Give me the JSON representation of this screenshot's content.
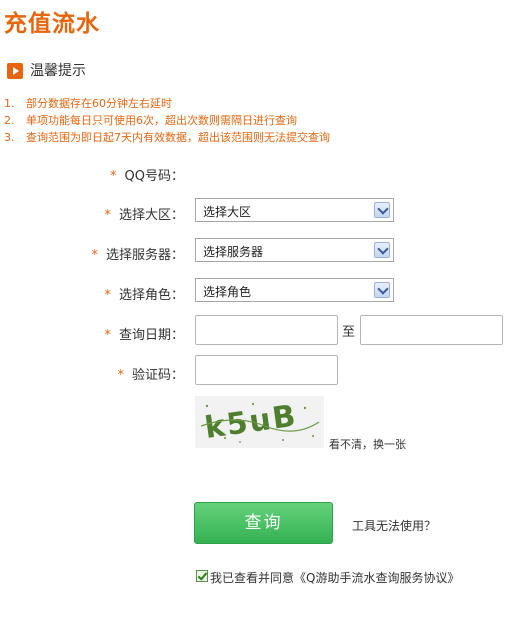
{
  "page": {
    "title": "充值流水"
  },
  "tips": {
    "title": "温馨提示",
    "items": [
      {
        "num": "1.",
        "text": "部分数据存在60分钟左右延时"
      },
      {
        "num": "2.",
        "text": "单项功能每日只可使用6次，超出次数则需隔日进行查询"
      },
      {
        "num": "3.",
        "text": "查询范围为即日起7天内有效数据，超出该范围则无法提交查询"
      }
    ]
  },
  "form": {
    "required_mark": "*",
    "qq": {
      "label": "QQ号码：",
      "value": ""
    },
    "region": {
      "label": "选择大区：",
      "selected": "选择大区"
    },
    "server": {
      "label": "选择服务器：",
      "selected": "选择服务器"
    },
    "role": {
      "label": "选择角色：",
      "selected": "选择角色"
    },
    "date": {
      "label": "查询日期：",
      "from": "",
      "separator": "至",
      "to": ""
    },
    "captcha": {
      "label": "验证码：",
      "value": "",
      "image_text": "k5uB",
      "refresh": "看不清，换一张"
    }
  },
  "actions": {
    "query": "查询",
    "help": "工具无法使用？",
    "agree_checked": true,
    "agree_text": "我已查看并同意《Q游助手流水查询服务协议》"
  },
  "colors": {
    "accent": "#e8650e",
    "button": "#3fbf5e"
  }
}
